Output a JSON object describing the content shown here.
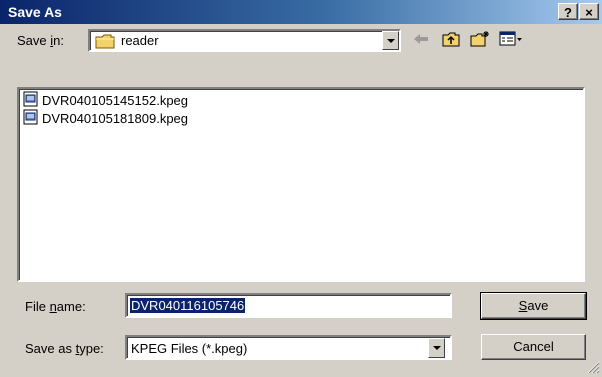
{
  "window": {
    "title": "Save As",
    "help_glyph": "?",
    "close_glyph": "×"
  },
  "save_in": {
    "label_pre": "Save ",
    "label_ul": "i",
    "label_post": "n:",
    "value": "reader"
  },
  "toolbar": {
    "icons": [
      "back-arrow-icon",
      "up-one-level-icon",
      "new-folder-icon",
      "view-menu-icon"
    ]
  },
  "files": [
    {
      "name": "DVR040105145152.kpeg",
      "icon": "file-icon"
    },
    {
      "name": "DVR040105181809.kpeg",
      "icon": "file-icon"
    }
  ],
  "file_name": {
    "label_pre": "File ",
    "label_ul": "n",
    "label_post": "ame:",
    "value": "DVR040116105746"
  },
  "save_as_type": {
    "label_pre": "Save as ",
    "label_ul": "t",
    "label_post": "ype:",
    "value": "KPEG Files (*.kpeg)"
  },
  "buttons": {
    "save_ul": "S",
    "save_rest": "ave",
    "cancel": "Cancel"
  }
}
